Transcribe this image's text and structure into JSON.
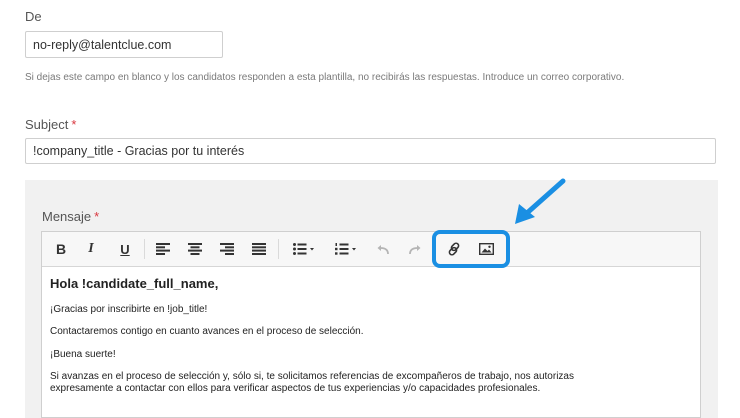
{
  "from": {
    "label": "De",
    "value": "no-reply@talentclue.com",
    "hint": "Si dejas este campo en blanco y los candidatos responden a esta plantilla, no recibirás las respuestas. Introduce un correo corporativo."
  },
  "subject": {
    "label": "Subject",
    "required_mark": "*",
    "value": "!company_title - Gracias por tu interés"
  },
  "message": {
    "label": "Mensaje",
    "required_mark": "*",
    "toolbar": {
      "bold": "B",
      "italic": "I",
      "underline": "U",
      "icons": [
        "align-left-icon",
        "align-center-icon",
        "align-right-icon",
        "align-justify-icon",
        "bullet-list-icon",
        "numbered-list-icon",
        "undo-icon",
        "redo-icon",
        "link-icon",
        "image-icon"
      ]
    },
    "body": {
      "greeting": "Hola !candidate_full_name,",
      "line1": "¡Gracias por inscribirte en !job_title!",
      "line2": "Contactaremos contigo en cuanto avances en el proceso de selección.",
      "line3": "¡Buena suerte!",
      "line4a": "Si avanzas en el proceso de selección y, sólo si, te solicitamos referencias de excompañeros de trabajo, nos autorizas",
      "line4b": "expresamente a contactar con ellos para verificar aspectos de tus experiencias y/o capacidades profesionales."
    }
  },
  "colors": {
    "highlight": "#1a8fe3",
    "required": "#d9363e",
    "panel_bg": "#f1f1f1"
  }
}
